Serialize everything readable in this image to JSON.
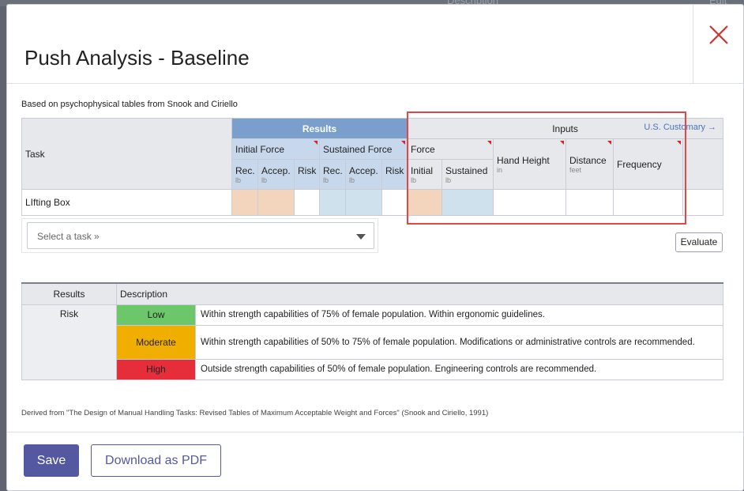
{
  "background": {
    "left_text": "",
    "right_text_1": "Description",
    "right_text_2": "Edit"
  },
  "modal": {
    "title": "Push Analysis - Baseline"
  },
  "subtitle": "Based on psychophysical tables from Snook and Ciriello",
  "table": {
    "task_header": "Task",
    "results_header": "Results",
    "inputs_header": "Inputs",
    "units_link": "U.S. Customary →",
    "initial_force": "Initial Force",
    "sustained_force": "Sustained Force",
    "force": "Force",
    "hand_height": "Hand Height",
    "hand_height_unit": "in",
    "distance": "Distance",
    "distance_unit": "feet",
    "frequency": "Frequency",
    "rec": "Rec.",
    "accep": "Accep.",
    "risk": "Risk",
    "initial": "Initial",
    "sustained": "Sustained",
    "lb": "lb",
    "rows": [
      {
        "task": "LIfting Box"
      }
    ]
  },
  "select": {
    "placeholder": "Select a task »"
  },
  "evaluate_label": "Evaluate",
  "legend": {
    "results_header": "Results",
    "description_header": "Description",
    "risk_label": "Risk",
    "levels": [
      {
        "name": "Low",
        "color": "#6cc76a",
        "text": "Within strength capabilities of 75% of female population. Within ergonomic guidelines."
      },
      {
        "name": "Moderate",
        "color": "#f0ae00",
        "text": "Within strength capabilities of 50% to 75% of female population. Modifications or administrative controls are recommended."
      },
      {
        "name": "High",
        "color": "#e52e3a",
        "text": "Outside strength capabilities of 50% of female population. Engineering controls are recommended."
      }
    ]
  },
  "footnote": "Derived from \"The Design of Manual Handling Tasks: Revised Tables of Maximum Acceptable Weight and Forces\" (Snook and Ciriello, 1991)",
  "footer": {
    "save": "Save",
    "download_pdf": "Download as PDF"
  },
  "colors": {
    "accent": "#5458a0",
    "results_header": "#7a9fcc",
    "highlight_box": "#e04848"
  }
}
